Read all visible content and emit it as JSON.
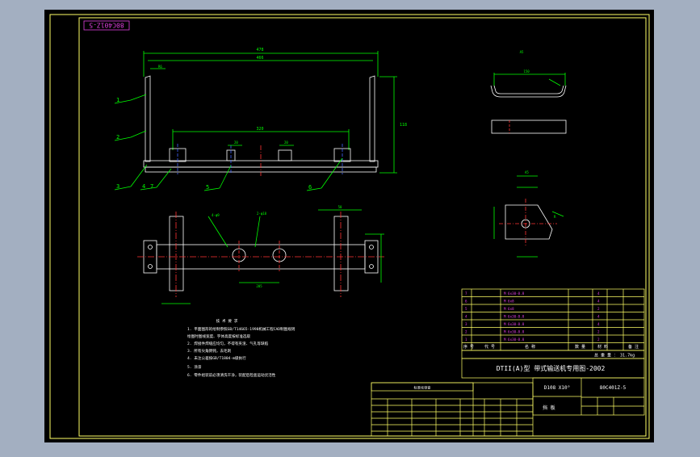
{
  "drawing_number_rotated": "80C401Z-5",
  "callouts": [
    "1",
    "2",
    "3",
    "4",
    "7",
    "5",
    "6"
  ],
  "notes": {
    "heading": "技 术 要 求",
    "lines": [
      "1. 平面图形的绘制参照GB/T14665-1998机械工程CAD制图规则",
      "   绘图时图线宽度、字体高度按标准选取",
      "2. 焊接件焊缝应均匀，不得有夹渣、气孔等缺陷",
      "3. 所有尖角倒钝，去毛刺",
      "4. 未注公差按GB/T1804-m级执行",
      "5. 涂漆",
      "6. 零件组装前必须清洗干净，装配后检查运动灵活性"
    ]
  },
  "parts_table": {
    "rows": [
      [
        "7",
        "M 6x30-8.8",
        "",
        "4",
        "",
        ""
      ],
      [
        "6",
        "M 6x8",
        "",
        "4",
        "",
        ""
      ],
      [
        "5",
        "M 6x8",
        "",
        "2",
        "",
        ""
      ],
      [
        "4",
        "M 6x30-8.8",
        "",
        "4",
        "",
        ""
      ],
      [
        "3",
        "M 6x30-8.8",
        "",
        "4",
        "",
        ""
      ],
      [
        "2",
        "M 6x30-8.8",
        "",
        "2",
        "",
        ""
      ],
      [
        "1",
        "M 6x30-8.8",
        "",
        "2",
        "",
        ""
      ]
    ],
    "header": [
      "序 号",
      "代 号",
      "名 称",
      "数 量",
      "材 料",
      "备 注"
    ],
    "summary": "总 重 量 ： 31.7kg",
    "project_title": "DTII(A)型 带式输送机专用图-2002",
    "spec": "D108 X10°",
    "drawing_code": "80C401Z-5",
    "part_name": "挡 板"
  },
  "revision_table": {
    "title": "标准化审查"
  }
}
